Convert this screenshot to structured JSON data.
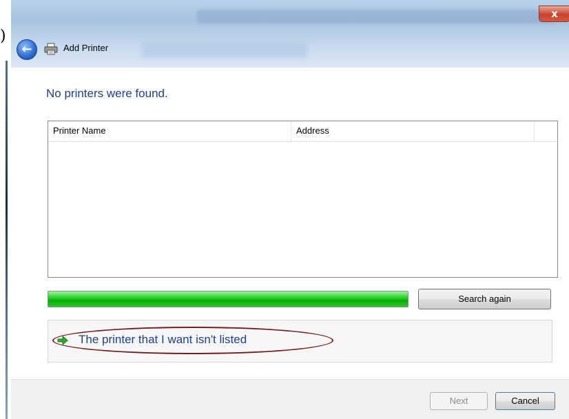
{
  "window": {
    "title": "Add Printer",
    "close_glyph": "x",
    "back_glyph": "←",
    "icons": {
      "back": "back-arrow-icon",
      "printer": "printer-icon",
      "close": "close-icon",
      "link_arrow": "green-arrow-icon"
    }
  },
  "margin_mark": ")",
  "main": {
    "heading": "No printers were found.",
    "list": {
      "columns": [
        "Printer Name",
        "Address",
        ""
      ],
      "rows": []
    },
    "progress": {
      "fraction": 1.0,
      "color": "#06b006"
    },
    "search_again_label": "Search again",
    "link_label": "The printer that I want isn't listed"
  },
  "footer": {
    "next_label": "Next",
    "cancel_label": "Cancel"
  },
  "colors": {
    "link": "#1e3f8c",
    "annotation_ellipse": "#7a1c1c",
    "close_button": "#c7442e"
  }
}
